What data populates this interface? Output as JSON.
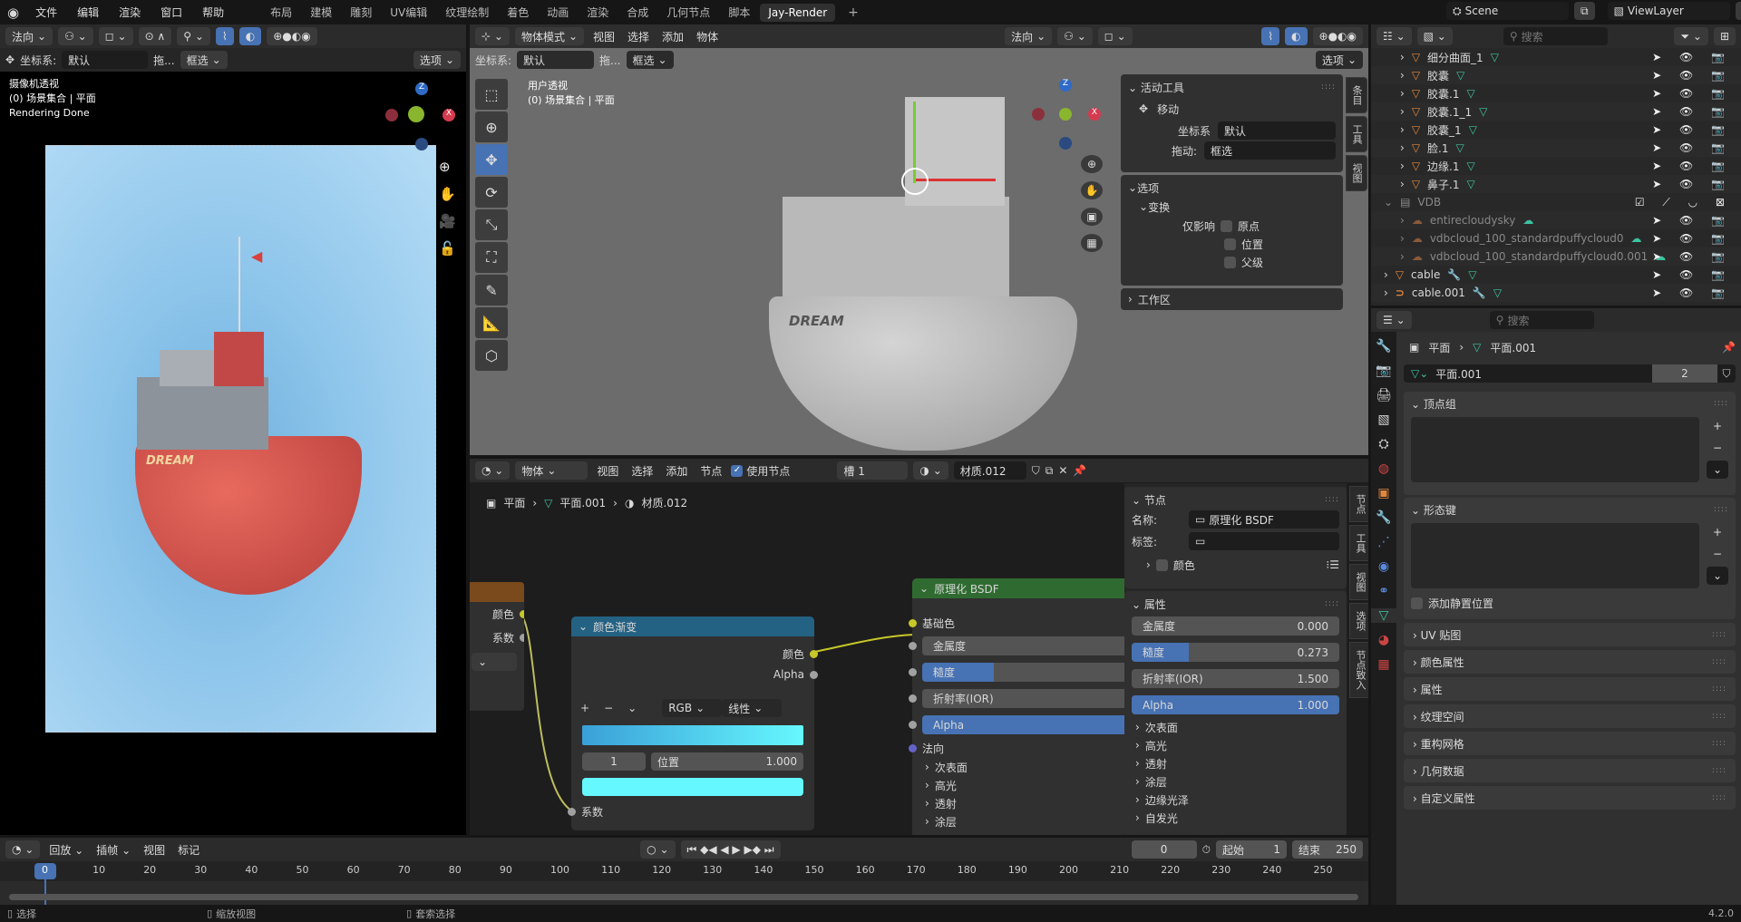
{
  "menu": {
    "items": [
      "文件",
      "编辑",
      "渲染",
      "窗口",
      "帮助"
    ]
  },
  "workspaces": [
    "布局",
    "建模",
    "雕刻",
    "UV编辑",
    "纹理绘制",
    "着色",
    "动画",
    "渲染",
    "合成",
    "几何节点",
    "脚本",
    "Jay-Render"
  ],
  "active_workspace": "Jay-Render",
  "scene": {
    "name": "Scene",
    "view_layer": "ViewLayer"
  },
  "render_view": {
    "orientation": "法向",
    "coord_label": "坐标系:",
    "coord_value": "默认",
    "drag_label": "拖...",
    "drag_value": "框选",
    "options": "选项",
    "overlay_title": "摄像机透视",
    "overlay_collection": "(0) 场景集合 | 平面",
    "overlay_status": "Rendering Done",
    "boat_text": "DREAM"
  },
  "viewport": {
    "mode": "物体模式",
    "menus": [
      "视图",
      "选择",
      "添加",
      "物体"
    ],
    "orientation": "法向",
    "coord_label": "坐标系:",
    "coord_value": "默认",
    "drag_label": "拖...",
    "drag_value": "框选",
    "options": "选项",
    "overlay_title": "用户透视",
    "overlay_collection": "(0) 场景集合 | 平面",
    "boat_text": "DREAM",
    "sidebar": {
      "active_tool": "活动工具",
      "tool_name": "移动",
      "coord_label": "坐标系",
      "coord_value": "默认",
      "drag_label": "拖动:",
      "drag_value": "框选",
      "options": "选项",
      "transform": "变换",
      "affect_only": "仅影响",
      "checks": [
        "原点",
        "位置",
        "父级"
      ],
      "workspace": "工作区",
      "tabs": [
        "条目",
        "工具",
        "视图"
      ]
    }
  },
  "node_editor": {
    "type": "物体",
    "menus": [
      "视图",
      "选择",
      "添加",
      "节点"
    ],
    "use_nodes": "使用节点",
    "slot": "槽 1",
    "material": "材质.012",
    "breadcrumb": [
      "平面",
      "平面.001",
      "材质.012"
    ],
    "left_node": {
      "outputs": [
        "颜色",
        "系数"
      ]
    },
    "color_ramp": {
      "title": "颜色渐变",
      "outputs": [
        "颜色",
        "Alpha"
      ],
      "mode": "RGB",
      "interp": "线性",
      "index": "1",
      "pos_label": "位置",
      "pos_value": "1.000",
      "input": "系数",
      "color_start": "#3aa0d8",
      "color_end": "#66f8ff"
    },
    "bsdf": {
      "title": "原理化 BSDF",
      "base_color": "基础色",
      "fields": [
        {
          "label": "金属度",
          "value": "0.0",
          "fill": 0
        },
        {
          "label": "糙度",
          "value": "0.2",
          "fill": 0.273
        },
        {
          "label": "折射率(IOR)",
          "value": "1.5",
          "fill": 0
        },
        {
          "label": "Alpha",
          "value": "1.0",
          "fill": 1
        }
      ],
      "normal": "法向",
      "subs": [
        "次表面",
        "高光",
        "透射",
        "涂层"
      ]
    },
    "sidebar": {
      "node": "节点",
      "name_label": "名称:",
      "name_value": "原理化 BSDF",
      "label_label": "标签:",
      "color": "颜色",
      "props": "属性",
      "fields": [
        {
          "label": "金属度",
          "value": "0.000",
          "fill": 0
        },
        {
          "label": "糙度",
          "value": "0.273",
          "fill": 0.273
        },
        {
          "label": "折射率(IOR)",
          "value": "1.500",
          "fill": 0
        },
        {
          "label": "Alpha",
          "value": "1.000",
          "fill": 1
        }
      ],
      "subs": [
        "次表面",
        "高光",
        "透射",
        "涂层",
        "边缘光泽",
        "自发光"
      ],
      "tabs": [
        "节点",
        "工具",
        "视图",
        "选项",
        "节点致入"
      ]
    }
  },
  "outliner": {
    "search_placeholder": "搜索",
    "items": [
      {
        "name": "细分曲面_1",
        "kind": "mesh",
        "indent": 2
      },
      {
        "name": "胶囊",
        "kind": "mesh",
        "indent": 2
      },
      {
        "name": "胶囊.1",
        "kind": "mesh",
        "indent": 2
      },
      {
        "name": "胶囊.1_1",
        "kind": "mesh",
        "indent": 2
      },
      {
        "name": "胶囊_1",
        "kind": "mesh",
        "indent": 2
      },
      {
        "name": "脸.1",
        "kind": "mesh",
        "indent": 2
      },
      {
        "name": "边缘.1",
        "kind": "mesh",
        "indent": 2
      },
      {
        "name": "鼻子.1",
        "kind": "mesh",
        "indent": 2
      },
      {
        "name": "VDB",
        "kind": "collection",
        "indent": 1
      },
      {
        "name": "entirecloudysky",
        "kind": "volume",
        "indent": 2
      },
      {
        "name": "vdbcloud_100_standardpuffycloud0",
        "kind": "volume",
        "indent": 2
      },
      {
        "name": "vdbcloud_100_standardpuffycloud0.001",
        "kind": "volume",
        "indent": 2
      },
      {
        "name": "cable",
        "kind": "mesh-mod",
        "indent": 1
      },
      {
        "name": "cable.001",
        "kind": "curve-mod",
        "indent": 1
      }
    ]
  },
  "properties": {
    "search_placeholder": "搜索",
    "breadcrumb": [
      "平面",
      "平面.001"
    ],
    "mesh_name": "平面.001",
    "users": "2",
    "vertex_groups": "顶点组",
    "shape_keys": "形态键",
    "add_rest": "添加静置位置",
    "sections": [
      "UV 贴图",
      "颜色属性",
      "属性",
      "纹理空间",
      "重构网格",
      "几何数据",
      "自定义属性"
    ]
  },
  "timeline": {
    "menus": [
      "回放",
      "插帧",
      "视图",
      "标记"
    ],
    "current": "0",
    "start_label": "起始",
    "start": "1",
    "end_label": "结束",
    "end": "250",
    "ticks": [
      "0",
      "10",
      "20",
      "30",
      "40",
      "50",
      "60",
      "70",
      "80",
      "90",
      "100",
      "110",
      "120",
      "130",
      "140",
      "150",
      "160",
      "170",
      "180",
      "190",
      "200",
      "210",
      "220",
      "230",
      "240",
      "250"
    ]
  },
  "status": {
    "select": "选择",
    "zoom": "缩放视图",
    "lasso": "套索选择",
    "version": "4.2.0"
  }
}
